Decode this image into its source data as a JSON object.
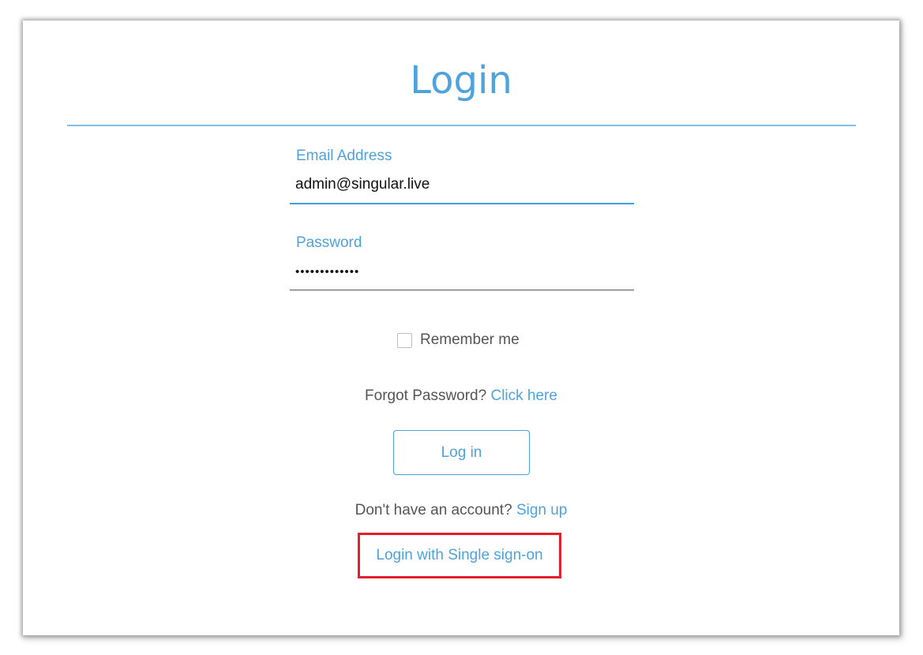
{
  "page": {
    "title": "Login"
  },
  "form": {
    "email_label": "Email Address",
    "email_value": "admin@singular.live",
    "password_label": "Password",
    "password_value": "•••••••••••••",
    "remember_label": "Remember me",
    "remember_checked": false
  },
  "forgot": {
    "text": "Forgot Password?",
    "link": "Click here"
  },
  "actions": {
    "login_label": "Log in"
  },
  "signup": {
    "text": "Don't have an account?",
    "link": "Sign up"
  },
  "sso": {
    "link": "Login with Single sign-on"
  },
  "colors": {
    "accent": "#4ea3dd",
    "highlight_border": "#e0202e",
    "muted_text": "#555555"
  }
}
